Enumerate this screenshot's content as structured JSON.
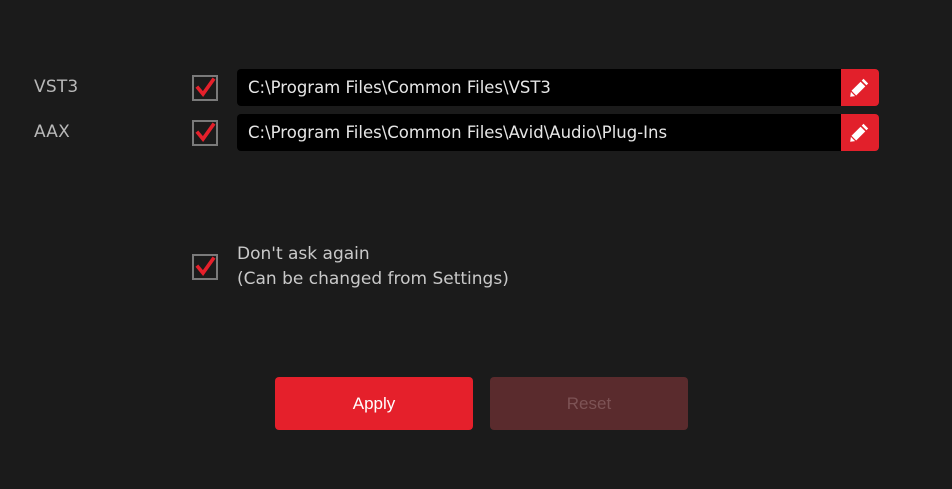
{
  "formats": [
    {
      "label": "VST3",
      "checked": true,
      "path": "C:\\Program Files\\Common Files\\VST3",
      "edit_icon": "pencil-icon"
    },
    {
      "label": "AAX",
      "checked": true,
      "path": "C:\\Program Files\\Common Files\\Avid\\Audio\\Plug-Ins",
      "edit_icon": "pencil-icon"
    }
  ],
  "dont_ask": {
    "checked": true,
    "line1": "Don't ask again",
    "line2": "(Can be changed from Settings)"
  },
  "buttons": {
    "apply_label": "Apply",
    "reset_label": "Reset"
  },
  "colors": {
    "background": "#1b1b1b",
    "accent": "#e5202b",
    "checkmark": "#e5202b",
    "disabled_button": "#5a2b2d",
    "path_field": "#000000"
  }
}
